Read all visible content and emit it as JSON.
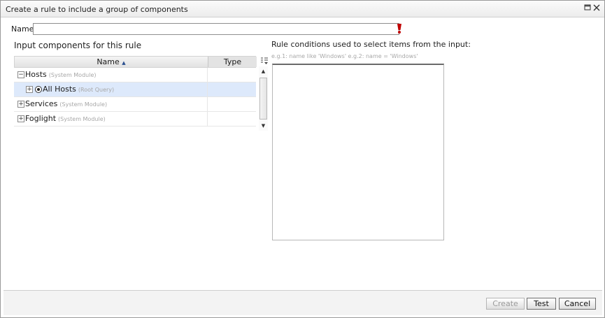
{
  "dialog": {
    "title": "Create a rule to include a group of components",
    "icons": {
      "maximize": "maximize-icon",
      "close": "close-icon"
    }
  },
  "name_field": {
    "label": "Name",
    "value": "",
    "required_icon": "required-indicator-icon",
    "required_color": "#c00000"
  },
  "input_components": {
    "title": "Input components for this rule",
    "columns": {
      "name": "Name",
      "type": "Type",
      "sort_icon": "sort-ascending-icon"
    },
    "rows": [
      {
        "label": "Hosts",
        "sublabel": "(System Module)",
        "expander": "−",
        "type": ""
      },
      {
        "label": "All Hosts",
        "sublabel": "(Root Query)",
        "expander": "+",
        "type": "",
        "selected": true
      },
      {
        "label": "Services",
        "sublabel": "(System Module)",
        "expander": "+",
        "type": ""
      },
      {
        "label": "Foglight",
        "sublabel": "(System Module)",
        "expander": "+",
        "type": ""
      }
    ],
    "column_chooser_icon": "column-chooser-icon"
  },
  "rule_conditions": {
    "title": "Rule conditions used to select items from the input:",
    "hint": "e.g.1: name like 'Windows' e.g.2: name = 'Windows'",
    "value": ""
  },
  "buttons": {
    "create": "Create",
    "test": "Test",
    "cancel": "Cancel"
  },
  "colors": {
    "selected_row": "#dde9fb",
    "required": "#c00000"
  }
}
